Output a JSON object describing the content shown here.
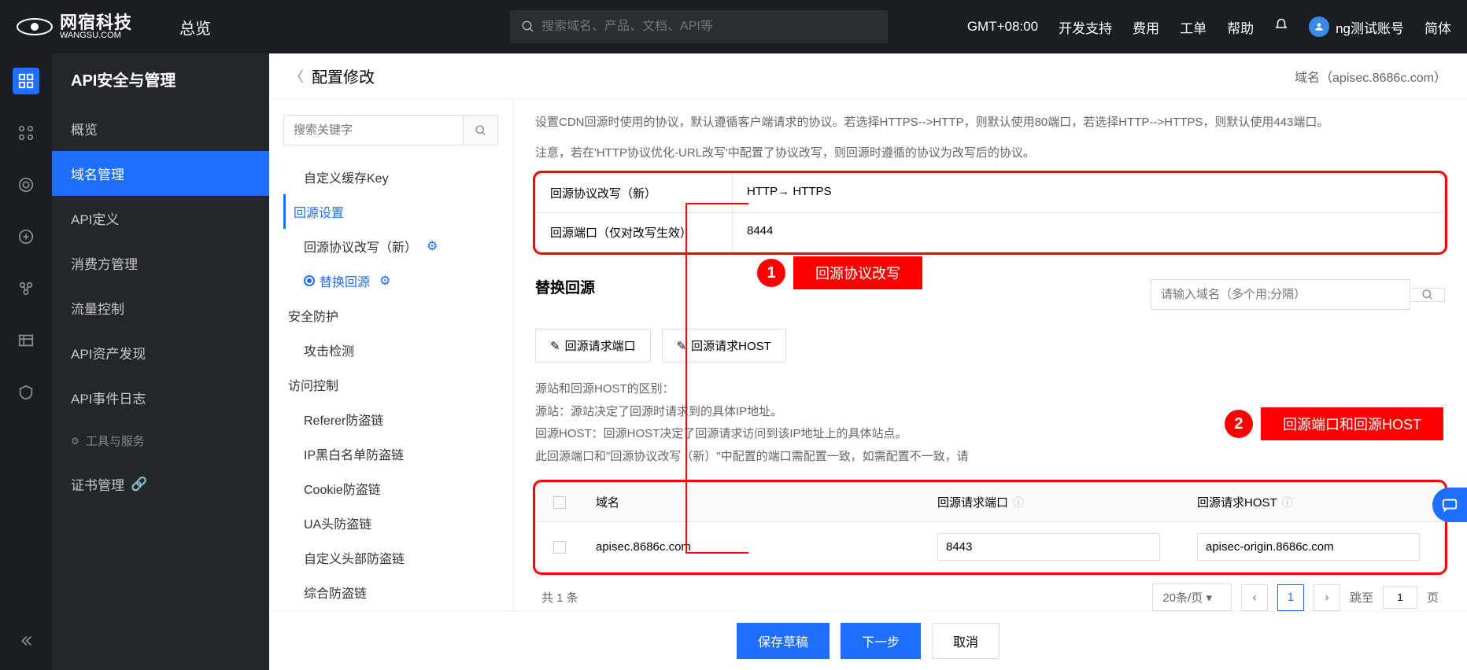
{
  "topbar": {
    "brand": "网宿科技",
    "brand_domain": "WANGSU.COM",
    "overview": "总览",
    "search_placeholder": "搜索域名、产品、文档、API等",
    "timezone": "GMT+08:00",
    "links": {
      "dev": "开发支持",
      "fee": "费用",
      "ticket": "工单",
      "help": "帮助"
    },
    "user": "ng测试账号",
    "lang": "简体"
  },
  "sidebar": {
    "title": "API安全与管理",
    "items": [
      "概览",
      "域名管理",
      "API定义",
      "消费方管理",
      "流量控制",
      "API资产发现",
      "API事件日志"
    ],
    "tools": "工具与服务",
    "cert": "证书管理"
  },
  "page": {
    "title": "配置修改",
    "domain_label": "域名",
    "domain_value": "（apisec.8686c.com）"
  },
  "sec_panel": {
    "search_placeholder": "搜索关键字",
    "items": {
      "cache_key": "自定义缓存Key",
      "origin_settings": "回源设置",
      "protocol_rewrite": "回源协议改写（新）",
      "replace_origin": "替换回源",
      "security": "安全防护",
      "attack_detect": "攻击检测",
      "access_control": "访问控制",
      "referer": "Referer防盗链",
      "ip_bw": "IP黑白名单防盗链",
      "cookie": "Cookie防盗链",
      "ua": "UA头防盗链",
      "custom_header": "自定义头部防盗链",
      "combined": "综合防盗链"
    }
  },
  "detail": {
    "help1": "设置CDN回源时使用的协议，默认遵循客户端请求的协议。若选择HTTPS-->HTTP，则默认使用80端口，若选择HTTP-->HTTPS，则默认使用443端口。",
    "help2": "注意，若在'HTTP协议优化-URL改写'中配置了协议改写，则回源时遵循的协议为改写后的协议。",
    "config_rows": [
      {
        "label": "回源协议改写（新）",
        "value": "HTTP→ HTTPS"
      },
      {
        "label": "回源端口（仅对改写生效）",
        "value": "8444"
      }
    ],
    "section_title": "替换回源",
    "filter_placeholder": "请输入域名（多个用;分隔）",
    "action1": "回源请求端口",
    "action2": "回源请求HOST",
    "desc": {
      "l1": "源站和回源HOST的区别：",
      "l2": "源站：源站决定了回源时请求到的具体IP地址。",
      "l3": "回源HOST：回源HOST决定了回源请求访问到该IP地址上的具体站点。",
      "l4": "此回源端口和\"回源协议改写（新）\"中配置的端口需配置一致，如需配置不一致，请"
    },
    "table": {
      "headers": {
        "domain": "域名",
        "port": "回源请求端口",
        "host": "回源请求HOST"
      },
      "rows": [
        {
          "domain": "apisec.8686c.com",
          "port": "8443",
          "host": "apisec-origin.8686c.com"
        }
      ]
    },
    "pagination": {
      "total": "共 1 条",
      "per_page": "20条/页",
      "page": "1",
      "jump": "跳至",
      "page_suffix": "页"
    }
  },
  "footer": {
    "save": "保存草稿",
    "next": "下一步",
    "cancel": "取消"
  },
  "callouts": {
    "c1": {
      "num": "1",
      "label": "回源协议改写"
    },
    "c2": {
      "num": "2",
      "label": "回源端口和回源HOST"
    }
  }
}
